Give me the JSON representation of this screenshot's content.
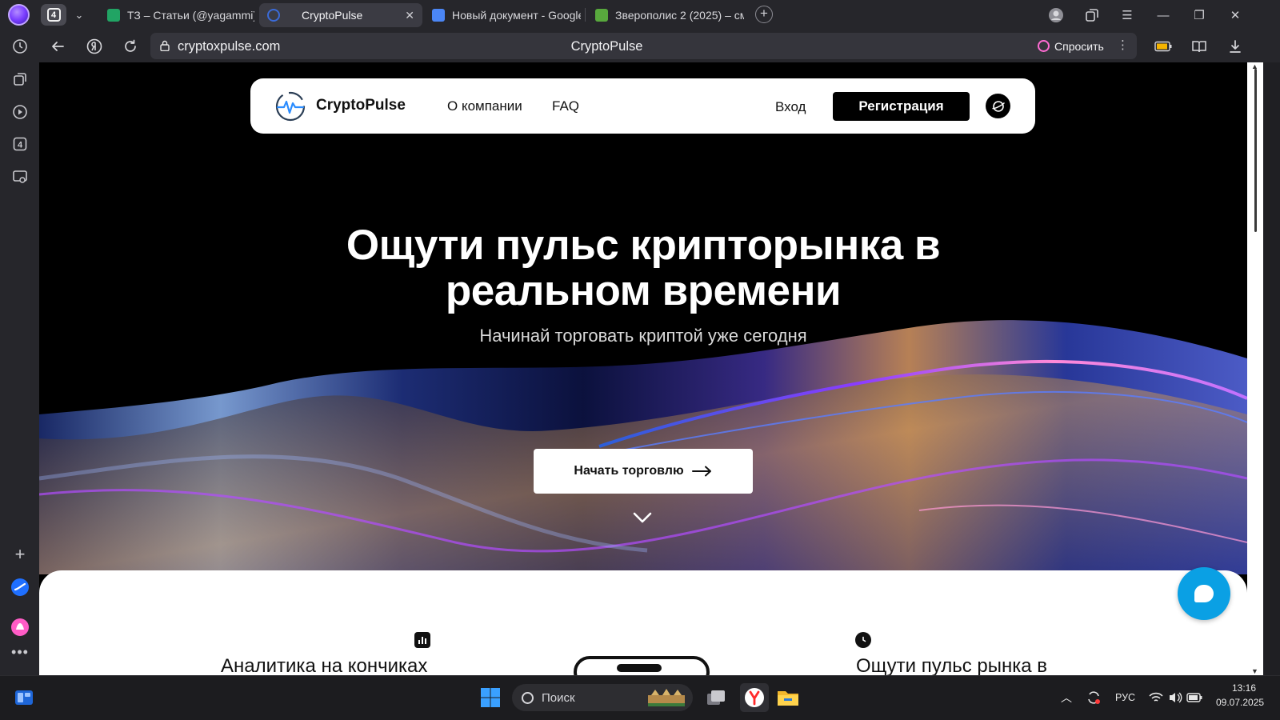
{
  "browser": {
    "tab_count": "4",
    "tabs": [
      {
        "title": "ТЗ – Статьи (@yagammi)",
        "favicon_color": "#21a464",
        "active": false
      },
      {
        "title": "CryptoPulse",
        "favicon_color": "#3b6bd8",
        "active": true
      },
      {
        "title": "Новый документ - Google",
        "favicon_color": "#4b86f5",
        "active": false
      },
      {
        "title": "Зверополис 2 (2025) – см",
        "favicon_color": "#58a83d",
        "active": false
      }
    ],
    "address": {
      "url": "cryptoxpulse.com",
      "page_title": "CryptoPulse"
    },
    "ask_button_label": "Спросить"
  },
  "site": {
    "logo_text": "CryptoPulse",
    "nav": {
      "about": "О компании",
      "faq": "FAQ",
      "login": "Вход",
      "register": "Регистрация"
    },
    "hero": {
      "title_line1": "Ощути пульс крипторынка в",
      "title_line2": "реальном времени",
      "subtitle": "Начинай торговать криптой уже сегодня",
      "cta": "Начать торговлю"
    },
    "features": {
      "left_title": "Аналитика на кончиках",
      "right_title": "Ощути пульс рынка в"
    }
  },
  "taskbar": {
    "search_placeholder": "Поиск",
    "language": "РУС",
    "time": "13:16",
    "date": "09.07.2025"
  },
  "colors": {
    "accent_chat": "#0aa0e4",
    "ask_icon": "#ff6bd3"
  }
}
